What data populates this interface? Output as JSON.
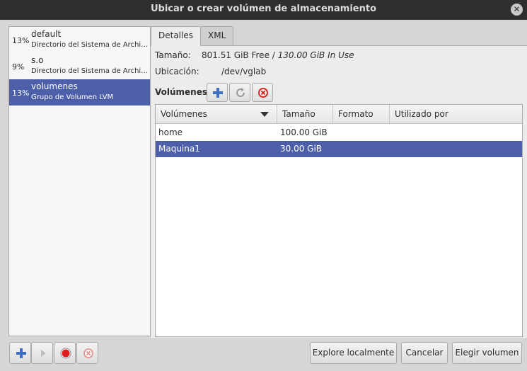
{
  "window": {
    "title": "Ubicar o crear volúmen de almacenamiento",
    "close_glyph": "✕"
  },
  "pools": [
    {
      "pct": "13%",
      "name": "default",
      "type": "Directorio del Sistema de Archivos",
      "selected": false
    },
    {
      "pct": "9%",
      "name": "s.o",
      "type": "Directorio del Sistema de Archivos",
      "selected": false
    },
    {
      "pct": "13%",
      "name": "volumenes",
      "type": "Grupo de Volumen LVM",
      "selected": true
    }
  ],
  "tabs": {
    "details": "Detalles",
    "xml": "XML"
  },
  "details": {
    "size_label": "Tamaño:",
    "size_free": "801.51 GiB Free / ",
    "size_in_use": "130.00 GiB In Use",
    "location_label": "Ubicación:",
    "location_value": "/dev/vglab",
    "volumes_label": "Volúmenes"
  },
  "volume_toolbar": {
    "add_icon": "plus-icon",
    "refresh_icon": "refresh-icon",
    "delete_icon": "delete-icon"
  },
  "table": {
    "headers": [
      "Volúmenes",
      "Tamaño",
      "Formato",
      "Utilizado por"
    ],
    "rows": [
      {
        "name": "home",
        "size": "100.00 GiB",
        "format": "",
        "used_by": "",
        "selected": false
      },
      {
        "name": "Maquina1",
        "size": "30.00 GiB",
        "format": "",
        "used_by": "",
        "selected": true
      }
    ]
  },
  "pool_toolbar": {
    "add_icon": "plus-icon",
    "start_icon": "play-icon",
    "stop_icon": "stop-record-icon",
    "delete_icon": "delete-icon"
  },
  "buttons": {
    "browse_local": "Explore localmente",
    "cancel": "Cancelar",
    "choose": "Elegir volumen"
  },
  "colors": {
    "selection": "#4c5fa8",
    "titlebar": "#2f2f2f",
    "stop_red": "#e01b1b",
    "add_blue": "#3c6fc4"
  }
}
